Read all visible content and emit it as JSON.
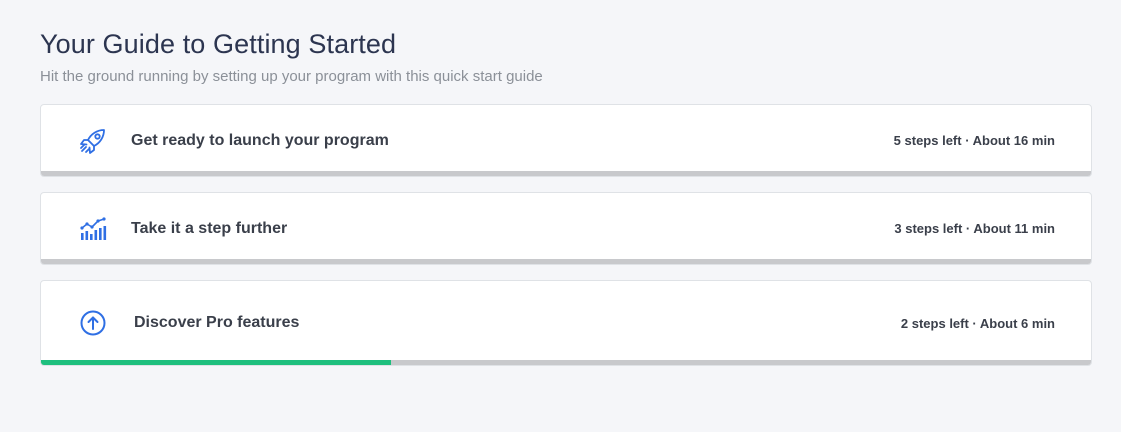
{
  "header": {
    "title": "Your Guide to Getting Started",
    "subtitle": "Hit the ground running by setting up your program with this quick start guide"
  },
  "colors": {
    "accent_icon": "#2f6fe4",
    "progress_fill": "#1ebf7e",
    "progress_track": "#c8c9cc"
  },
  "guides": [
    {
      "icon": "rocket-icon",
      "title": "Get ready to launch your program",
      "meta": "5 steps left · About 16 min",
      "progress": 0
    },
    {
      "icon": "growth-chart-icon",
      "title": "Take it a step further",
      "meta": "3 steps left · About 11 min",
      "progress": 0
    },
    {
      "icon": "arrow-up-circle-icon",
      "title": "Discover Pro features",
      "meta": "2 steps left · About 6 min",
      "progress": 0.333
    }
  ]
}
